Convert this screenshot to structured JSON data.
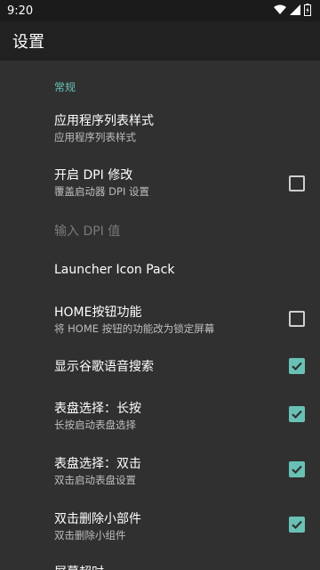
{
  "status": {
    "time": "9:20"
  },
  "appbar": {
    "title": "设置"
  },
  "category": "常规",
  "items": [
    {
      "title": "应用程序列表样式",
      "summary": "应用程序列表样式"
    },
    {
      "title": "开启 DPI 修改",
      "summary": "覆盖启动器 DPI 设置",
      "checked": false
    },
    {
      "title": "输入 DPI 值",
      "disabled": true
    },
    {
      "title": "Launcher Icon Pack"
    },
    {
      "title": "HOME按钮功能",
      "summary": "将 HOME 按钮的功能改为锁定屏幕",
      "checked": false
    },
    {
      "title": "显示谷歌语音搜索",
      "checked": true
    },
    {
      "title": "表盘选择：长按",
      "summary": "长按启动表盘选择",
      "checked": true
    },
    {
      "title": "表盘选择：双击",
      "summary": "双击启动表盘设置",
      "checked": true
    },
    {
      "title": "双击删除小部件",
      "summary": "双击删除小组件",
      "checked": true
    },
    {
      "title": "屏幕超时"
    }
  ],
  "colors": {
    "accent": "#69c1b5",
    "background": "#303030",
    "appbar": "#212121",
    "statusbar": "#1b1b1b"
  }
}
